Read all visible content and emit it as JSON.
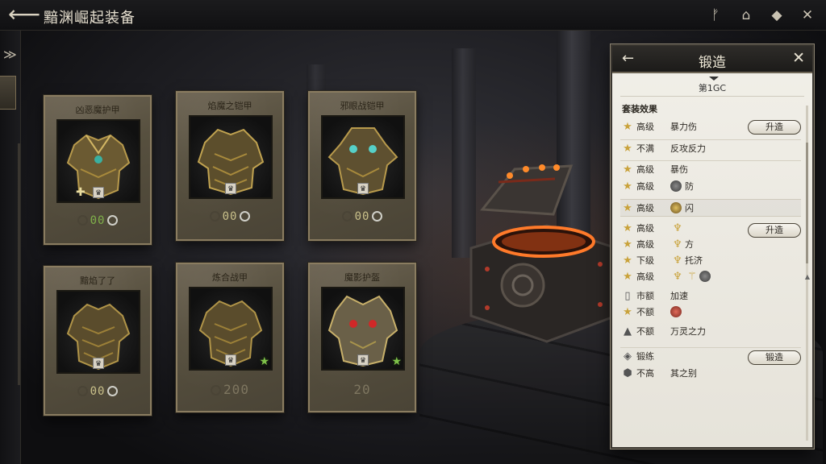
{
  "header": {
    "title": "黯渊崛起装备",
    "back_icon": "back-arrow-icon",
    "icons": [
      "rune-icon",
      "academy-icon",
      "cube-icon",
      "close-icon"
    ]
  },
  "cards": [
    {
      "name": "凶恶魔护甲",
      "value": "00",
      "badges": [
        "plus",
        "rank"
      ]
    },
    {
      "name": "焰魔之铠甲",
      "value": "00",
      "badges": [
        "rank"
      ]
    },
    {
      "name": "邪眼战铠甲",
      "value": "00",
      "badges": [
        "rank"
      ]
    },
    {
      "name": "黯焰了了",
      "value": "00",
      "badges": [
        "rank"
      ]
    },
    {
      "name": "炼合战甲",
      "value": "200",
      "badges": [
        "rank",
        "star"
      ]
    },
    {
      "name": "魔影护盔",
      "value": "20",
      "badges": [
        "rank",
        "star"
      ]
    }
  ],
  "forge_panel": {
    "title": "锻造",
    "subtitle": "第1GC",
    "section_title": "套装效果",
    "buttons": [
      "升造",
      "升造",
      "锻造"
    ],
    "rows": [
      {
        "label": "高级",
        "value": "暴力伤",
        "icon": "star-icon"
      },
      {
        "label": "不满",
        "value": "反攻反力",
        "icon": "star-icon"
      },
      {
        "label": "高级",
        "value": "暴伤",
        "icon": "star-icon"
      },
      {
        "label": "高级",
        "value": "防",
        "icon": "star-icon",
        "token": "gray"
      },
      {
        "label": "高级",
        "value": "闪",
        "icon": "star-icon",
        "token": "gold"
      },
      {
        "label": "高级",
        "value": "",
        "icon": "star-icon",
        "token": "gold-lamp"
      },
      {
        "label": "高级",
        "value": "方",
        "icon": "star-icon",
        "token": "lamp"
      },
      {
        "label": "下级",
        "value": "托济",
        "icon": "star-icon",
        "token": "lamp"
      },
      {
        "label": "高级",
        "value": "",
        "icon": "star-icon",
        "token": "lamp-bird"
      },
      {
        "label": "市额",
        "value": "加速",
        "icon": "scroll-icon"
      },
      {
        "label": "不额",
        "value": "",
        "icon": "star-icon",
        "token": "red"
      },
      {
        "label": "不额",
        "value": "万灵之力",
        "icon": "pyramid-icon"
      },
      {
        "label": "锻练",
        "value": "",
        "icon": "diamond-icon"
      },
      {
        "label": "不高",
        "value": "其之别",
        "icon": "gem-icon"
      }
    ]
  }
}
